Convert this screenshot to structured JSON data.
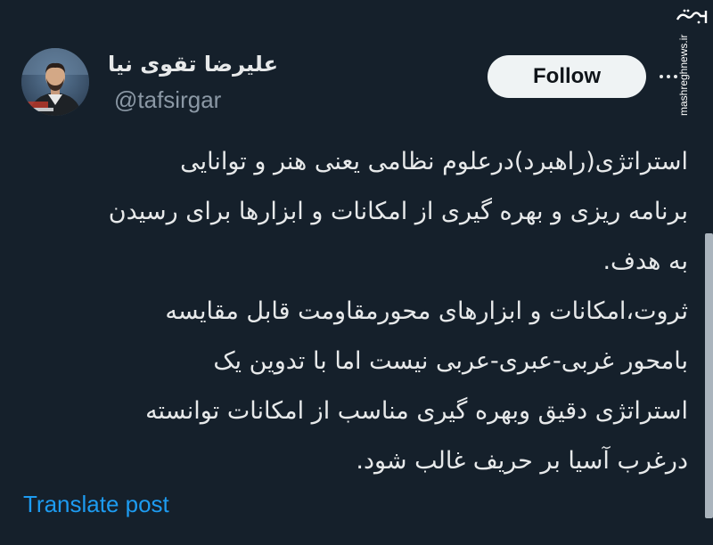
{
  "author": {
    "display_name": "علیرضا تقوی نیا",
    "handle": "@tafsirgar"
  },
  "actions": {
    "follow_label": "Follow"
  },
  "tweet": {
    "lines": [
      "استراتژی(راهبرد)درعلوم نظامی یعنی هنر و توانایی",
      "برنامه ریزی و بهره گیری از امکانات و ابزارها برای رسیدن",
      "به هدف.",
      "ثروت،امکانات و ابزارهای محورمقاومت قابل مقایسه",
      "بامحور غربی-عبری-عربی نیست اما با تدوین یک",
      "استراتژی دقیق وبهره گیری مناسب از امکانات توانسته",
      "درغرب آسیا بر حریف غالب شود."
    ]
  },
  "footer": {
    "translate_label": "Translate post"
  },
  "watermark": {
    "text": "mashreghnews.ir"
  },
  "colors": {
    "background": "#15202b",
    "text": "#e7e9ea",
    "muted": "#8b98a5",
    "link": "#1d9bf0",
    "follow_bg": "#eff3f4"
  },
  "icons": {
    "more": "more-dots-icon",
    "logo": "watermark-logo-icon"
  }
}
